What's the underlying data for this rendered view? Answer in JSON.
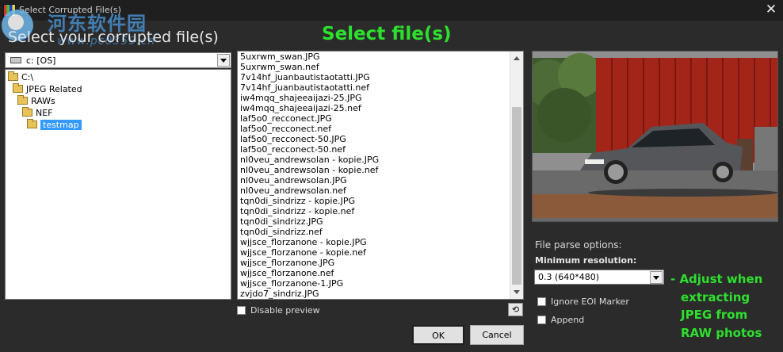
{
  "window": {
    "title": "Select Corrupted File(s)"
  },
  "watermark": {
    "cn": "河东软件园",
    "url": "www.pc0359.cn"
  },
  "heading": "Select your corrupted file(s)",
  "annotations": {
    "select_files": "Select file(s)",
    "adjust_lines": [
      "- Adjust when",
      "extracting",
      "JPEG from",
      "RAW photos"
    ]
  },
  "drive": {
    "selected": "c: [OS]"
  },
  "folder_tree": [
    {
      "label": "C:\\",
      "depth": 0
    },
    {
      "label": "JPEG Related",
      "depth": 1
    },
    {
      "label": "RAWs",
      "depth": 2
    },
    {
      "label": "NEF",
      "depth": 3
    },
    {
      "label": "testmap",
      "depth": 4,
      "selected": true
    }
  ],
  "files": [
    "5uxrwm_swan.JPG",
    "5uxrwm_swan.nef",
    "7v14hf_juanbautistaotatti.JPG",
    "7v14hf_juanbautistaotatti.nef",
    "iw4mqq_shajeeaijazi-25.JPG",
    "iw4mqq_shajeeaijazi-25.nef",
    "laf5o0_recconect.JPG",
    "laf5o0_recconect.nef",
    "laf5o0_recconect-50.JPG",
    "laf5o0_recconect-50.nef",
    "nl0veu_andrewsolan - kopie.JPG",
    "nl0veu_andrewsolan - kopie.nef",
    "nl0veu_andrewsolan.JPG",
    "nl0veu_andrewsolan.nef",
    "tqn0di_sindrizz - kopie.JPG",
    "tqn0di_sindrizz - kopie.nef",
    "tqn0di_sindrizz.JPG",
    "tqn0di_sindrizz.nef",
    "wjjsce_florzanone - kopie.JPG",
    "wjjsce_florzanone - kopie.nef",
    "wjjsce_florzanone.JPG",
    "wjjsce_florzanone.nef",
    "wjjsce_florzanone-1.JPG",
    "zvjdo7_sindriz.JPG"
  ],
  "preview": {
    "disable_label": "Disable preview",
    "refresh_symbol": "⟲"
  },
  "buttons": {
    "ok": "OK",
    "cancel": "Cancel"
  },
  "options": {
    "title": "File parse options:",
    "min_res_label": "Minimum resolution:",
    "min_res_value": "0.3 (640*480)",
    "ignore_eoi": "Ignore EOI Marker",
    "append": "Append"
  },
  "colors": {
    "annotation_green": "#2ee02e",
    "selection_blue": "#3399ff",
    "dialog_bg": "#2b2b2b"
  }
}
